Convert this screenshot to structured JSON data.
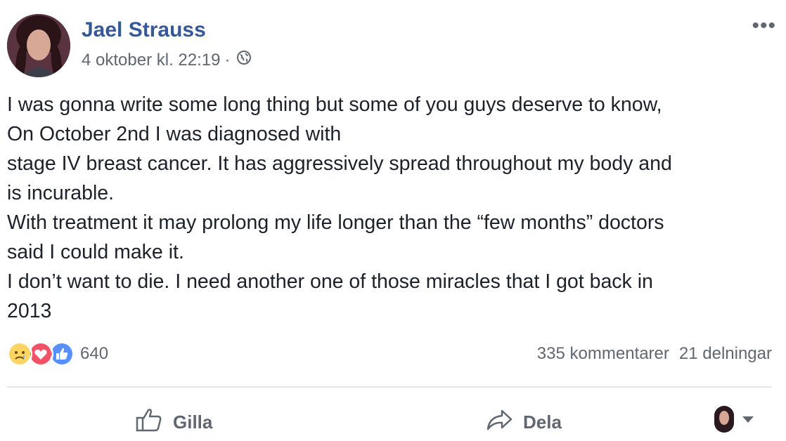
{
  "post": {
    "author": "Jael Strauss",
    "timestamp": "4 oktober kl. 22:19",
    "separator": "·",
    "privacy_icon": "globe-icon",
    "more_label": "•••",
    "body_lines": [
      "I was gonna write some long thing but some of you guys deserve to know,",
      "On October 2nd I was diagnosed with",
      "stage IV breast cancer. It has aggressively spread throughout my body and",
      "is incurable.",
      "With treatment it may prolong my life longer than the “few months” doctors",
      "said I could make it.",
      "I don’t want to die. I need another one of those miracles that I got back in",
      "2013"
    ]
  },
  "reactions": {
    "types": [
      "sad-reaction-icon",
      "love-reaction-icon",
      "like-reaction-icon"
    ],
    "count": "640",
    "comments": "335 kommentarer",
    "shares": "21 delningar"
  },
  "actions": {
    "like_label": "Gilla",
    "share_label": "Dela"
  },
  "colors": {
    "author_link": "#365899",
    "secondary_text": "#616770",
    "like_blue": "#5890ff",
    "love_red": "#f25268",
    "sad_yellow": "#fcd462"
  }
}
